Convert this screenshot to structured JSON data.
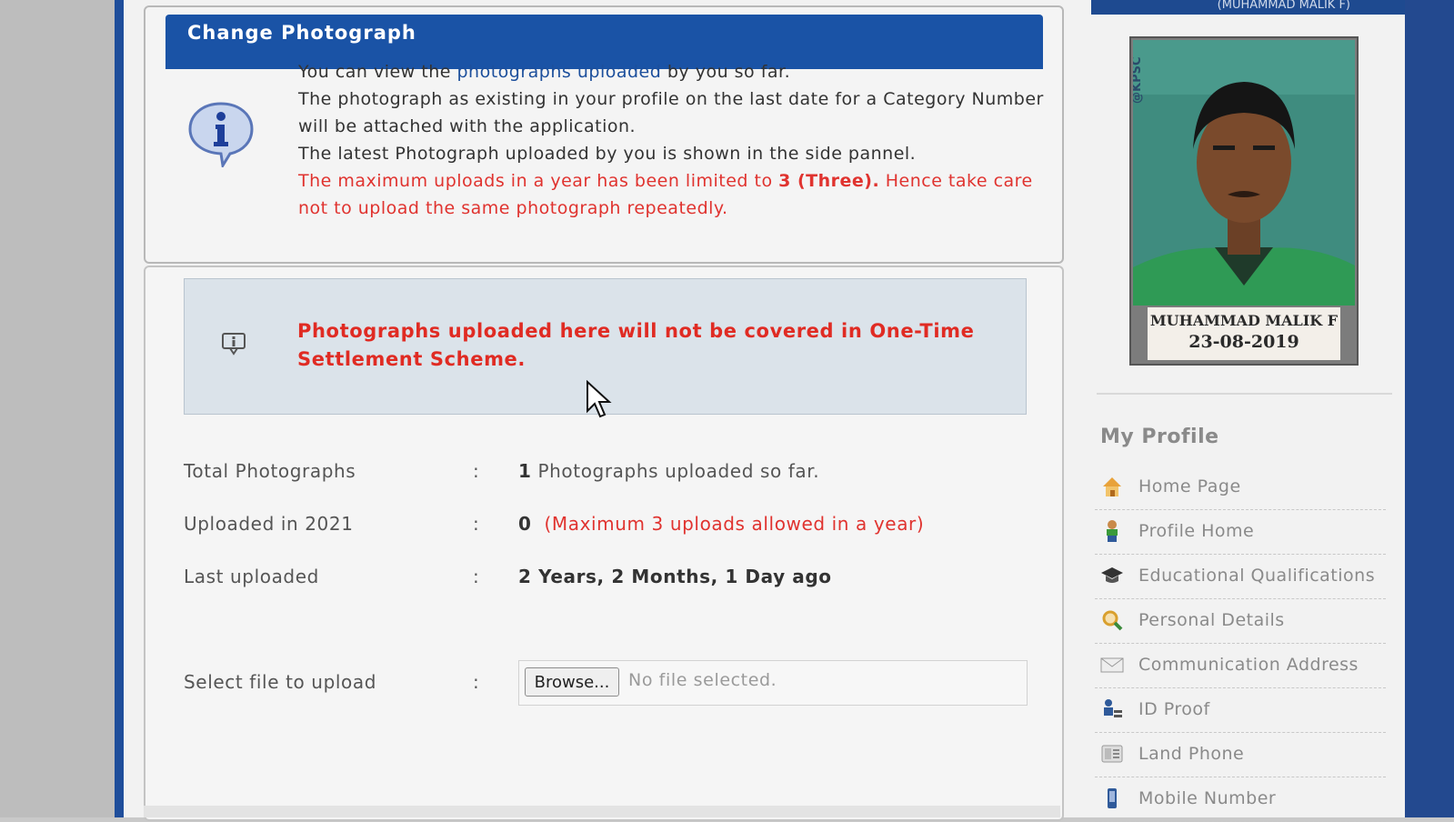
{
  "header": {
    "user_label": "(MUHAMMAD MALIK F)"
  },
  "panel": {
    "title": "Change Photograph",
    "info": {
      "line1_pre": "You can view the ",
      "line1_link": "photographs uploaded",
      "line1_post": " by you so far.",
      "line2": "The photograph as existing in your profile on the last date for a Category Number will be attached with the application.",
      "line3": "The latest Photograph uploaded by you is shown in the side pannel.",
      "warn_pre": "The maximum uploads in a year has been limited to ",
      "warn_bold": "3 (Three).",
      "warn_post": " Hence take care not to upload the same photograph repeatedly."
    },
    "notice": "Photographs uploaded here will not be covered in One-Time Settlement Scheme.",
    "stats": {
      "total": {
        "label": "Total Photographs",
        "count": "1",
        "text": "Photographs uploaded so far."
      },
      "year": {
        "label": "Uploaded in 2021",
        "count": "0",
        "note": "(Maximum 3 uploads allowed in a year)"
      },
      "last": {
        "label": "Last uploaded",
        "value": "2 Years, 2 Months, 1 Day ago"
      }
    },
    "upload": {
      "label": "Select file to upload",
      "browse": "Browse...",
      "status": "No file selected."
    },
    "colon": ":"
  },
  "sidebar": {
    "photo": {
      "watermark": "@KPSC",
      "name": "MUHAMMAD MALIK F",
      "date": "23-08-2019"
    },
    "title": "My Profile",
    "items": [
      {
        "label": "Home Page",
        "icon": "home-icon"
      },
      {
        "label": "Profile Home",
        "icon": "person-icon"
      },
      {
        "label": "Educational Qualifications",
        "icon": "graduation-cap-icon"
      },
      {
        "label": "Personal Details",
        "icon": "magnifier-icon"
      },
      {
        "label": "Communication Address",
        "icon": "envelope-icon"
      },
      {
        "label": "ID Proof",
        "icon": "id-proof-icon"
      },
      {
        "label": "Land Phone",
        "icon": "phone-icon"
      },
      {
        "label": "Mobile Number",
        "icon": "mobile-icon"
      }
    ]
  },
  "colors": {
    "title_bar": "#1a53a6",
    "warning_red": "#e0332f",
    "notice_bg": "#dbe3ea",
    "frame_blue": "#1f4e9b"
  }
}
